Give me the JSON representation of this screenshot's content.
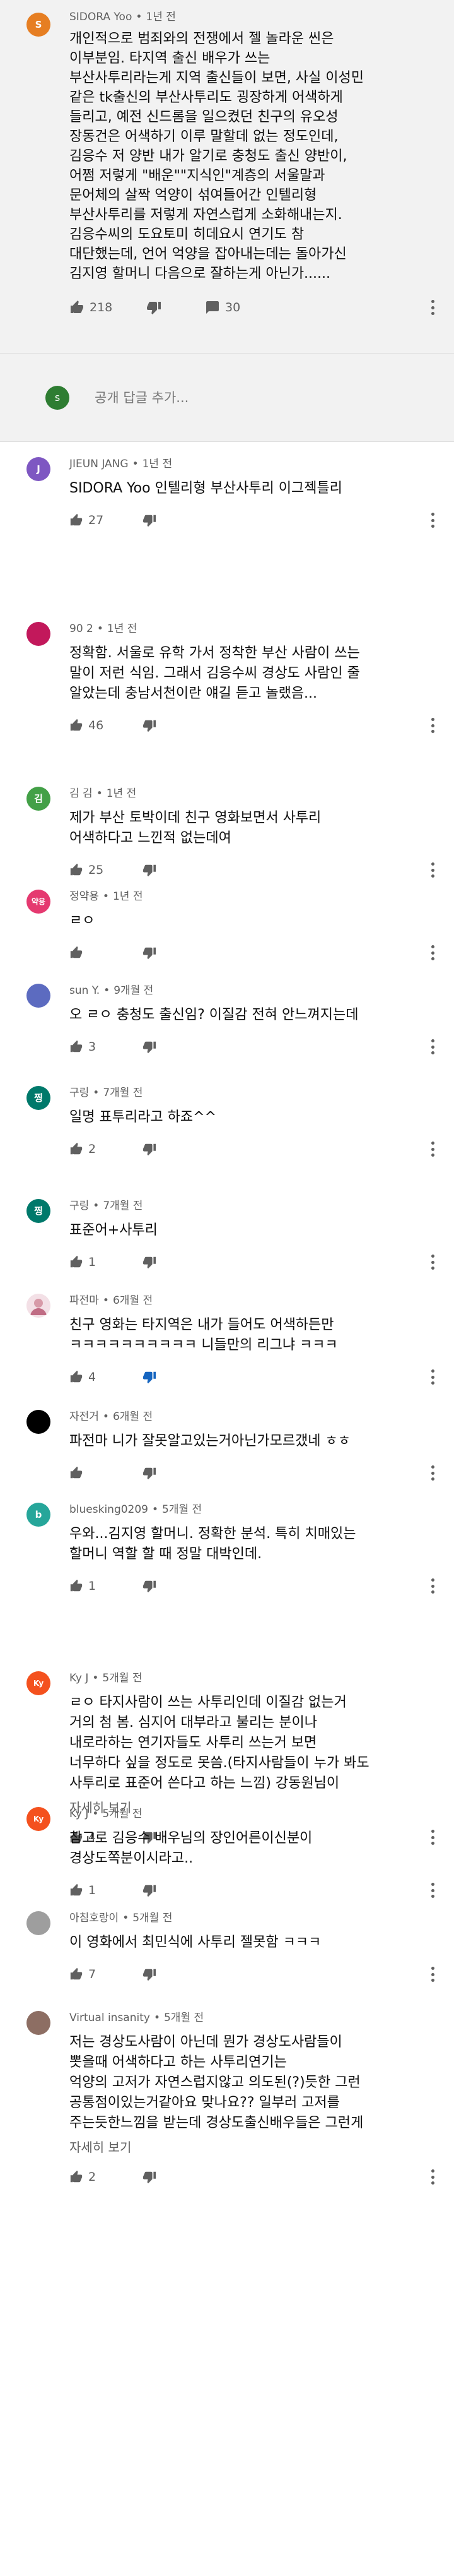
{
  "main_comment": {
    "avatar_letter": "S",
    "avatar_color": "#e67e22",
    "author": "SIDORA Yoo",
    "time": "1년 전",
    "text": "개인적으로 범죄와의 전쟁에서 젤 놀라운 씬은\n이부분임. 타지역 출신 배우가 쓰는\n부산사투리라는게 지역 출신들이 보면, 사실 이성민\n같은 tk출신의 부산사투리도 굉장하게 어색하게\n들리고, 예전 신드롬을 일으켰던 친구의 유오성\n장동건은 어색하기 이루 말할데 없는 정도인데,\n김응수 저 양반 내가 알기로 충청도 출신 양반이,\n어쩜 저렇게 \"배운\"\"지식인\"계층의 서울말과\n문어체의 살짝 억양이 섞여들어간 인텔리형\n부산사투리를 저렇게 자연스럽게 소화해내는지.\n김응수씨의 도요토미 히데요시 연기도 참\n대단했는데, 언어 억양을 잡아내는데는 돌아가신\n김지영 할머니 다음으로 잘하는게 아닌가......",
    "likes": "218",
    "replies": "30"
  },
  "reply_box": {
    "avatar_letter": "s",
    "avatar_color": "#2e7d32",
    "placeholder": "공개 답글 추가..."
  },
  "replies": [
    {
      "author": "JIEUN JANG",
      "time": "1년 전",
      "avatar_letter": "J",
      "avatar_color": "#7e57c2",
      "text": "SIDORA Yoo 인텔리형 부산사투리 이그젝틀리",
      "likes": "27",
      "more": "",
      "disliked": false
    },
    {
      "author": "90 2",
      "time": "1년 전",
      "avatar_letter": "",
      "avatar_color": "#c2185b",
      "text": "정확함. 서울로 유학 가서 정착한 부산 사람이 쓰는\n말이 저런 식임. 그래서 김응수씨 경상도 사람인 줄\n알았는데 충남서천이란 얘길 듣고 놀랬음...",
      "likes": "46",
      "more": "",
      "disliked": false
    },
    {
      "author": "김 김",
      "time": "1년 전",
      "avatar_letter": "김",
      "avatar_color": "#43a047",
      "text": "제가 부산 토박이데 친구 영화보면서 사투리\n어색하다고 느낀적 없는데여",
      "likes": "25",
      "more": "",
      "disliked": false
    },
    {
      "author": "정약용",
      "time": "1년 전",
      "avatar_letter": "약용",
      "avatar_color": "#e53970",
      "text": "ㄹㅇ",
      "likes": "",
      "more": "",
      "disliked": false
    },
    {
      "author": "sun Y.",
      "time": "9개월 전",
      "avatar_letter": "",
      "avatar_color": "#5c6bc0",
      "text": "오 ㄹㅇ 충청도 출신임? 이질감 전혀 안느껴지는데",
      "likes": "3",
      "more": "",
      "disliked": false
    },
    {
      "author": "구링",
      "time": "7개월 전",
      "avatar_letter": "찡",
      "avatar_color": "#00796b",
      "text": "일명 표투리라고 하죠^^",
      "likes": "2",
      "more": "",
      "disliked": false
    },
    {
      "author": "구링",
      "time": "7개월 전",
      "avatar_letter": "찡",
      "avatar_color": "#00796b",
      "text": "표준어+사투리",
      "likes": "1",
      "more": "",
      "disliked": false
    },
    {
      "author": "파전마",
      "time": "6개월 전",
      "avatar_letter": "",
      "avatar_color": "#f3e0e6",
      "text": "친구 영화는 타지역은 내가 들어도 어색하든만\nㅋㅋㅋㅋㅋㅋㅋㅋㅋㅋ 니들만의 리그냐 ㅋㅋㅋ",
      "likes": "4",
      "more": "",
      "disliked": true
    },
    {
      "author": "자전거",
      "time": "6개월 전",
      "avatar_letter": "",
      "avatar_color": "#000000",
      "text": "파전마 니가 잘못알고있는거아닌가모르갰네 ㅎㅎ",
      "likes": "",
      "more": "",
      "disliked": false
    },
    {
      "author": "bluesking0209",
      "time": "5개월 전",
      "avatar_letter": "b",
      "avatar_color": "#26a69a",
      "text": "우와...김지영 할머니. 정확한 분석. 특히 치매있는\n할머니 역할 할 때 정말 대박인데.",
      "likes": "1",
      "more": "",
      "disliked": false
    },
    {
      "author": "Ky J",
      "time": "5개월 전",
      "avatar_letter": "Ky",
      "avatar_color": "#f4511e",
      "text": "ㄹㅇ 타지사람이 쓰는 사투리인데 이질감 없는거\n거의 첨 봄. 심지어 대부라고 불리는 분이나\n내로라하는 연기자들도 사투리 쓰는거 보면\n너무하다 싶을 정도로 못씀.(타지사람들이 누가 봐도\n사투리로 표준어 쓴다고 하는 느낌) 강동원님이",
      "likes": "4",
      "more": "자세히 보기",
      "disliked": false
    },
    {
      "author": "Ky J",
      "time": "5개월 전",
      "avatar_letter": "Ky",
      "avatar_color": "#f4511e",
      "text": "참고로 김응수 배우님의 장인어른이신분이\n경상도쪽분이시라고..",
      "likes": "1",
      "more": "",
      "disliked": false
    },
    {
      "author": "아침호랑이",
      "time": "5개월 전",
      "avatar_letter": "",
      "avatar_color": "#9e9e9e",
      "text": "이 영화에서  최민식에 사투리 젤못함 ㅋㅋㅋ",
      "likes": "7",
      "more": "",
      "disliked": false
    },
    {
      "author": "Virtual insanity",
      "time": "5개월 전",
      "avatar_letter": "",
      "avatar_color": "#8d6e63",
      "text": "저는 경상도사람이 아닌데 뭔가 경상도사람들이\n뽓을때 어색하다고 하는 사투리연기는\n억양의 고저가 자연스럽지않고 의도된(?)듯한 그런\n공통점이있는거같아요 맞나요?? 일부러 고저를\n주는듯한느낌을 받는데 경상도출신배우들은 그런게",
      "likes": "2",
      "more": "자세히 보기",
      "disliked": false
    }
  ]
}
